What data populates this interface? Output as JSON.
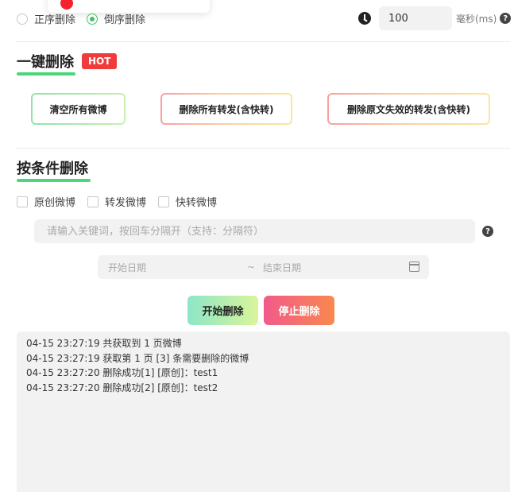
{
  "order_options": [
    {
      "label": "正序删除",
      "selected": false
    },
    {
      "label": "倒序删除",
      "selected": true
    }
  ],
  "interval": {
    "value": "100",
    "unit": "毫秒(ms)",
    "help": "?"
  },
  "one_click": {
    "title": "一键删除",
    "badge": "HOT",
    "buttons": [
      "清空所有微博",
      "删除所有转发(含快转)",
      "删除原文失效的转发(含快转)"
    ]
  },
  "conditional": {
    "title": "按条件删除",
    "checkboxes": [
      "原创微博",
      "转发微博",
      "快转微博"
    ],
    "keyword_placeholder": "请输入关键词，按回车分隔开（支持：分隔符）",
    "keyword_help": "?",
    "start_date_placeholder": "开始日期",
    "date_separator": "~",
    "end_date_placeholder": "结束日期"
  },
  "actions": {
    "start": "开始删除",
    "stop": "停止删除"
  },
  "log_lines": [
    "04-15 23:27:19 共获取到 1 页微博",
    "04-15 23:27:19 获取第 1 页 [3] 条需要删除的微博",
    "04-15 23:27:20 删除成功[1] [原创]：test1",
    "04-15 23:27:20 删除成功[2] [原创]：test2"
  ],
  "colors": {
    "accent_green": "#3fc36a",
    "hot_red": "#ef3b3b",
    "stop_pink": "#f25a8c"
  }
}
